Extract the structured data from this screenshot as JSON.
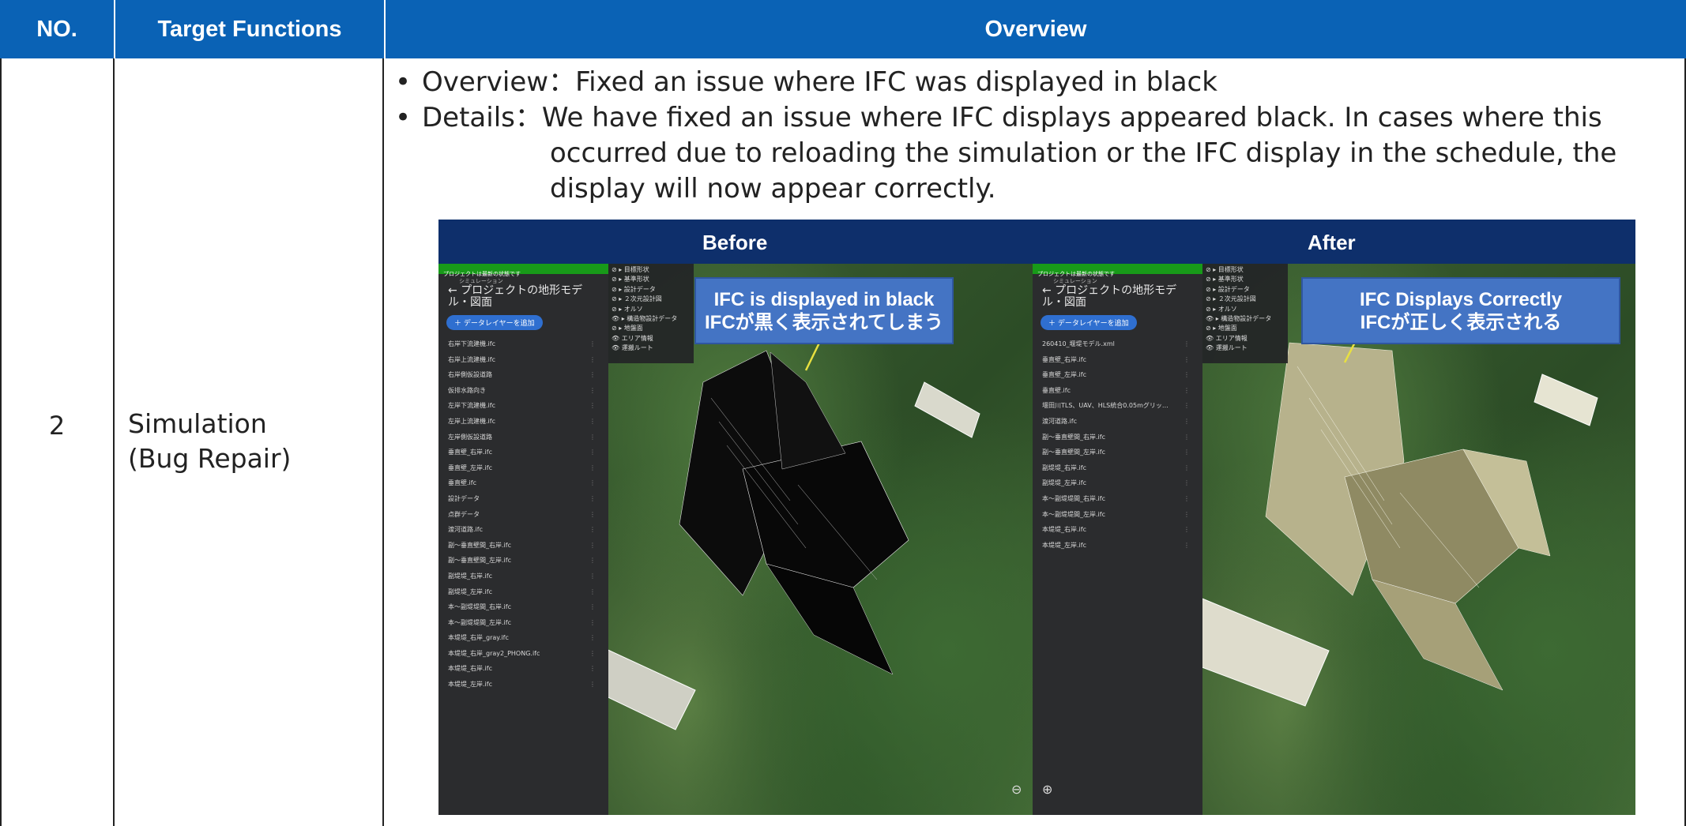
{
  "table": {
    "headers": {
      "no": "NO.",
      "functions": "Target Functions",
      "overview": "Overview"
    },
    "row": {
      "no": "2",
      "function_line1": "Simulation",
      "function_line2": "(Bug Repair)",
      "overview_label": "Overview：",
      "overview_text": "Fixed an issue where IFC was displayed in black",
      "details_label": "Details：",
      "details_line1": "We have fixed an issue where IFC displays appeared black. In cases where this",
      "details_line2": "occurred due to reloading the simulation or the IFC display in the schedule, the",
      "details_line3": "display will now appear correctly."
    }
  },
  "figure": {
    "before_label": "Before",
    "after_label": "After",
    "before_callout": [
      "IFC is displayed in black",
      "IFCが黒く表示されてしまう"
    ],
    "after_callout": [
      "IFC Displays Correctly",
      "IFCが正しく表示される"
    ],
    "sidebar_notice": "プロジェクトは最新の状態です",
    "sidebar_subtitle": "シミュレーション",
    "sidebar_title": "← プロジェクトの地形モデル・図面",
    "add_layer_button": "＋ データレイヤーを追加",
    "before_items": [
      "右岸下流建機.ifc",
      "右岸上流建機.ifc",
      "右岸側仮設道路",
      "仮排水路向き",
      "左岸下流建機.ifc",
      "左岸上流建機.ifc",
      "左岸側仮設道路",
      "垂直壁_右岸.ifc",
      "垂直壁_左岸.ifc",
      "垂直壁.ifc",
      "設計データ",
      "点群データ",
      "渡河道路.ifc",
      "副～垂直壁間_右岸.ifc",
      "副～垂直壁間_左岸.ifc",
      "副堤堤_右岸.ifc",
      "副堤堤_左岸.ifc",
      "本～副堤堤間_右岸.ifc",
      "本～副堤堤間_左岸.ifc",
      "本堤堤_右岸_gray.ifc",
      "本堤堤_右岸_gray2_PHONG.ifc",
      "本堤堤_右岸.ifc",
      "本堤堤_左岸.ifc"
    ],
    "after_items": [
      "260410_堰堤モデル.xml",
      "垂直壁_右岸.ifc",
      "垂直壁_左岸.ifc",
      "垂直壁.ifc",
      "堰田川TLS、UAV、HLS統合0.05mグリッ…",
      "渡河道路.ifc",
      "副～垂直壁間_右岸.ifc",
      "副～垂直壁間_左岸.ifc",
      "副堤堤_右岸.ifc",
      "副堤堤_左岸.ifc",
      "本～副堤堤間_右岸.ifc",
      "本～副堤堤間_左岸.ifc",
      "本堤堤_右岸.ifc",
      "本堤堤_左岸.ifc"
    ],
    "layer_items": [
      "⊘ ▸ 目標形状",
      "⊘ ▸ 基準形状",
      "⊘ ▸ 設計データ",
      "⊘ ▸ ２次元設計図",
      "⊘ ▸ オルソ",
      "👁 ▸ 構造物設計データ",
      "⊘ ▸ 地盤面",
      "👁 エリア情報",
      "👁 運搬ルート"
    ],
    "colors": {
      "header_blue": "#0a62b5",
      "figure_header": "#0e2f6b",
      "callout": "#4474c4",
      "notice_green": "#189a19"
    }
  }
}
